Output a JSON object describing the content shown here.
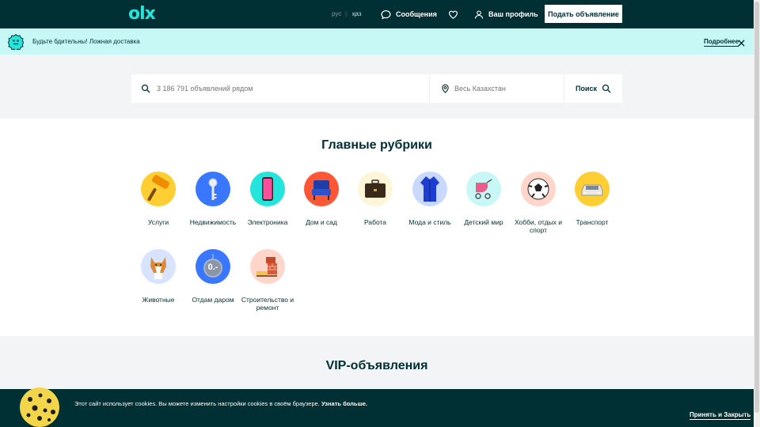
{
  "header": {
    "logo": "olx",
    "lang_ru": "рус",
    "lang_sep": "|",
    "lang_kz": "қаз",
    "messages": "Сообщения",
    "profile": "Ваш профиль",
    "post_ad": "Подать объявление"
  },
  "banner": {
    "text": "Будьте бдительны! Ложная доставка",
    "more": "Подробнее"
  },
  "search": {
    "query_placeholder": "3 186 791 объявлений рядом",
    "location_placeholder": "Весь Казахстан",
    "button": "Поиск"
  },
  "categories": {
    "title": "Главные рубрики",
    "items": [
      {
        "label": "Услуги",
        "icon": "paint-roller-icon",
        "bg": "#ffce32"
      },
      {
        "label": "Недвижимость",
        "icon": "key-icon",
        "bg": "#3a77ff"
      },
      {
        "label": "Электроника",
        "icon": "smartphone-icon",
        "bg": "#23e5db"
      },
      {
        "label": "Дом и сад",
        "icon": "armchair-icon",
        "bg": "#ff5636"
      },
      {
        "label": "Работа",
        "icon": "briefcase-icon",
        "bg": "#fff6d9"
      },
      {
        "label": "Мода и стиль",
        "icon": "robe-icon",
        "bg": "#c8d8ff"
      },
      {
        "label": "Детский мир",
        "icon": "stroller-icon",
        "bg": "#c8f8f6"
      },
      {
        "label": "Хобби, отдых и спорт",
        "icon": "soccer-ball-icon",
        "bg": "#ffd6c9"
      },
      {
        "label": "Транспорт",
        "icon": "car-icon",
        "bg": "#ffce32"
      },
      {
        "label": "Животные",
        "icon": "dog-icon",
        "bg": "#d8e3ff"
      },
      {
        "label": "Отдам даром",
        "icon": "free-tag-icon",
        "bg": "#3a77ff",
        "tag": "0.-"
      },
      {
        "label": "Строительство и ремонт",
        "icon": "bricks-icon",
        "bg": "#ffd6c9"
      }
    ]
  },
  "vip": {
    "title": "VIP-объявления"
  },
  "cookie": {
    "text": "Этот сайт использует cookies. Вы можете изменить настройки cookies в своём браузере.",
    "learn_more": "Узнать больше.",
    "accept": "Принять и Закрыть"
  },
  "colors": {
    "brand_dark": "#002f34",
    "brand_teal": "#23e5db",
    "banner_bg": "#c8f8f6",
    "page_bg": "#f2f4f5"
  }
}
